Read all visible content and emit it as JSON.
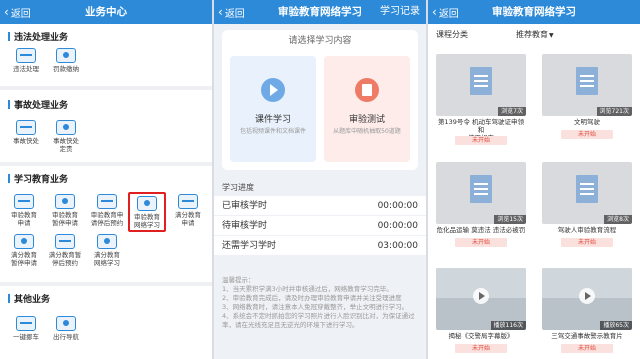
{
  "panel1": {
    "nav": {
      "back": "返回",
      "title": "业务中心"
    },
    "sections": [
      {
        "title": "违法处理业务",
        "items": [
          "违法处理",
          "罚款缴纳"
        ]
      },
      {
        "title": "事故处理业务",
        "items": [
          "事故快处",
          "事故快处\n定责"
        ]
      },
      {
        "title": "学习教育业务",
        "items": [
          "审验教育\n申请",
          "审验教育\n暂停申请",
          "审验教育申\n请停后预约",
          "审验教育\n网络学习",
          "满分教育\n申请",
          "满分教育\n暂停申请",
          "满分教育暂\n停后预约",
          "满分教育\n网络学习"
        ]
      },
      {
        "title": "其他业务",
        "items": [
          "一键挪车",
          "出行导航"
        ]
      }
    ]
  },
  "panel2": {
    "nav": {
      "back": "返回",
      "title": "审验教育网络学习",
      "right": "学习记录"
    },
    "choose_title": "请选择学习内容",
    "options": [
      {
        "title": "课件学习",
        "desc": "包括视频课件和文档课件"
      },
      {
        "title": "审验测试",
        "desc": "从题库中随机抽取50道题"
      }
    ],
    "progress_title": "学习进度",
    "progress": [
      {
        "label": "已审核学时",
        "value": "00:00:00"
      },
      {
        "label": "待审核学时",
        "value": "00:00:00"
      },
      {
        "label": "还需学习学时",
        "value": "03:00:00"
      }
    ],
    "tips": [
      "温馨提示：",
      "1、当天累积学满3小时并审核通过后，网络教育学习完毕。",
      "2、审验教育完成后，请及时办理审验教育申请并关注受理进度",
      "3、网络教育时，请注意本人免冠穿戴整齐，举止文明进行学习。",
      "4、系统会不定时抓拍您的学习照片进行人脸识别比对，为保证通过率，请在光线充足且无逆光的环境下进行学习。"
    ]
  },
  "panel3": {
    "nav": {
      "back": "返回",
      "title": "审验教育网络学习"
    },
    "filters": {
      "category": "课程分类",
      "sort": "推荐教育"
    },
    "courses": [
      {
        "views": "浏览7次",
        "title": "第139号令 机动车驾驶证申领和\n使用规定",
        "status": "未开始",
        "thumb": "doc"
      },
      {
        "views": "浏览721次",
        "title": "文明驾驶",
        "status": "未开始",
        "thumb": "doc"
      },
      {
        "views": "浏览15次",
        "title": "危化品运输 莫违法 违法必被罚",
        "status": "未开始",
        "thumb": "doc"
      },
      {
        "views": "浏览8次",
        "title": "驾驶人审验教育流程",
        "status": "未开始",
        "thumb": "doc"
      },
      {
        "views": "播放116次",
        "title": "揭秘《交警局字幕版》",
        "status": "未开始",
        "thumb": "video"
      },
      {
        "views": "播放65次",
        "title": "三驾交通事故警示教育片",
        "status": "未开始",
        "thumb": "video"
      }
    ]
  },
  "colors": {
    "nav": "#2d8ad8",
    "highlight": "#e02020",
    "status": "#e0493a"
  }
}
